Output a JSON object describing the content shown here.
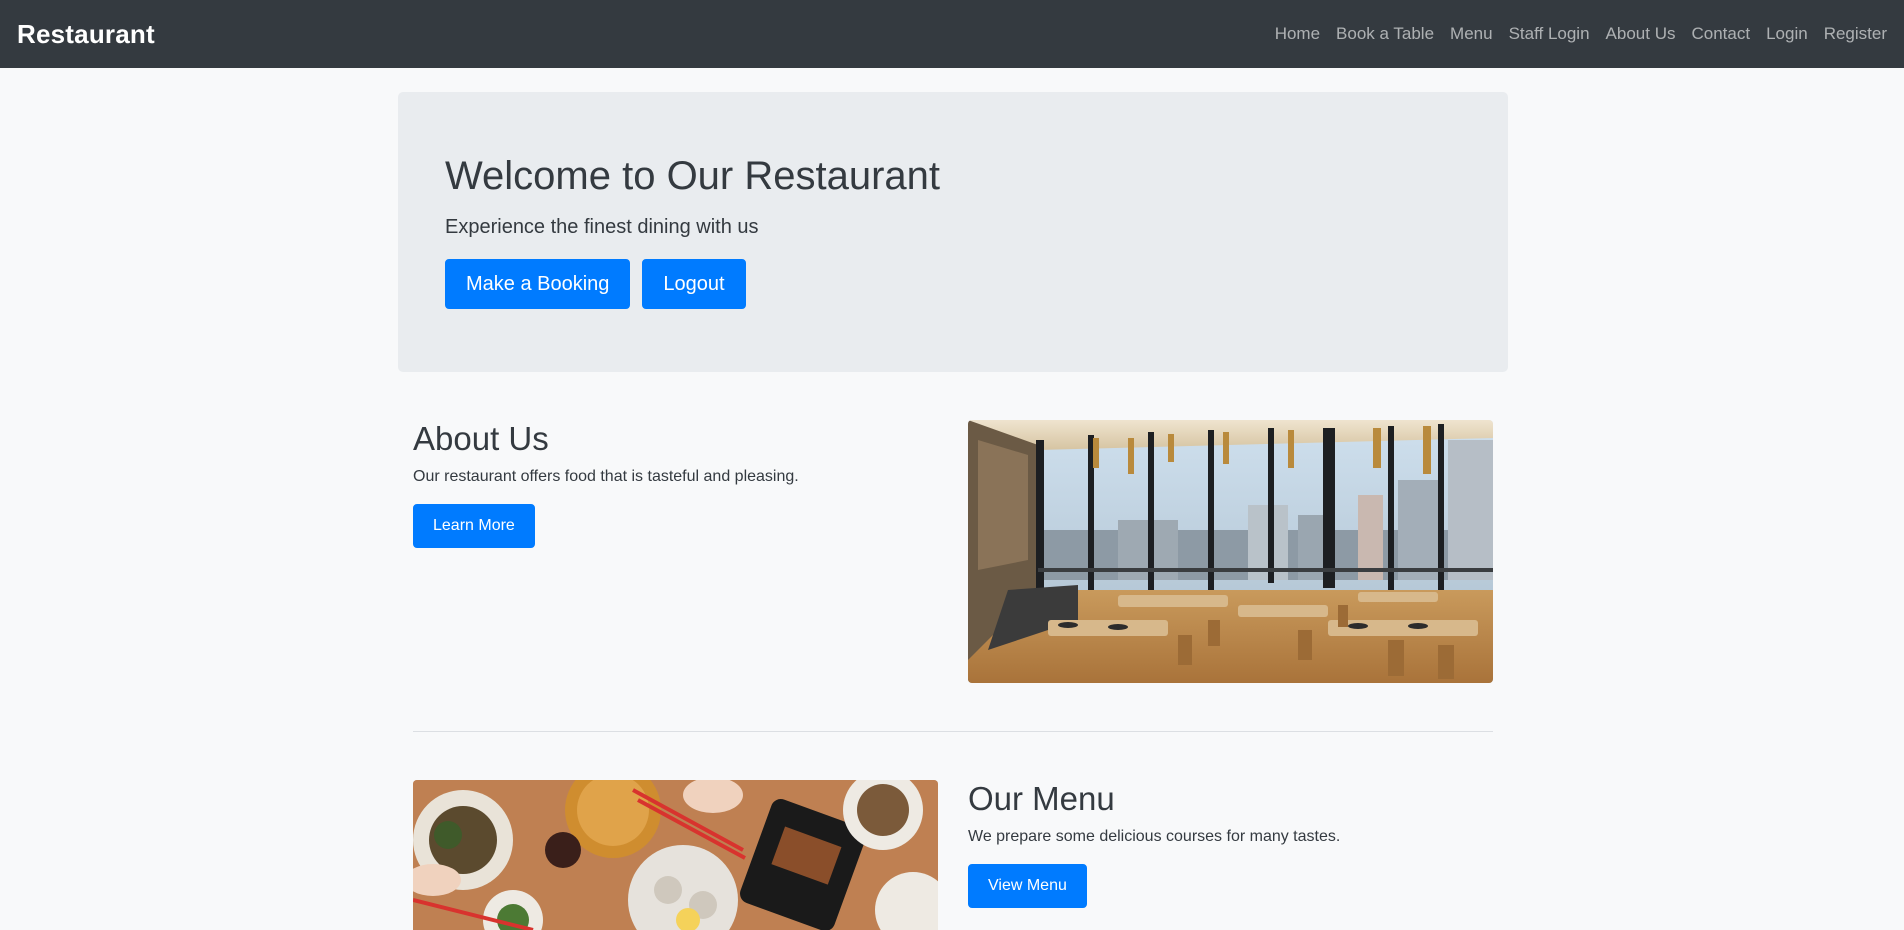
{
  "navbar": {
    "brand": "Restaurant",
    "links": [
      "Home",
      "Book a Table",
      "Menu",
      "Staff Login",
      "About Us",
      "Contact",
      "Login",
      "Register"
    ]
  },
  "hero": {
    "title": "Welcome to Our Restaurant",
    "lead": "Experience the finest dining with us",
    "booking_button": "Make a Booking",
    "logout_button": "Logout"
  },
  "about": {
    "title": "About Us",
    "text": "Our restaurant offers food that is tasteful and pleasing.",
    "button": "Learn More",
    "image_icon": "restaurant-interior-photo"
  },
  "menu": {
    "title": "Our Menu",
    "text": "We prepare some delicious courses for many tastes.",
    "button": "View Menu",
    "image_icon": "dishes-on-table-photo"
  },
  "colors": {
    "navbar": "#343a40",
    "primary": "#007bff",
    "jumbotron": "#e9ecef",
    "page": "#f8f9fa"
  }
}
